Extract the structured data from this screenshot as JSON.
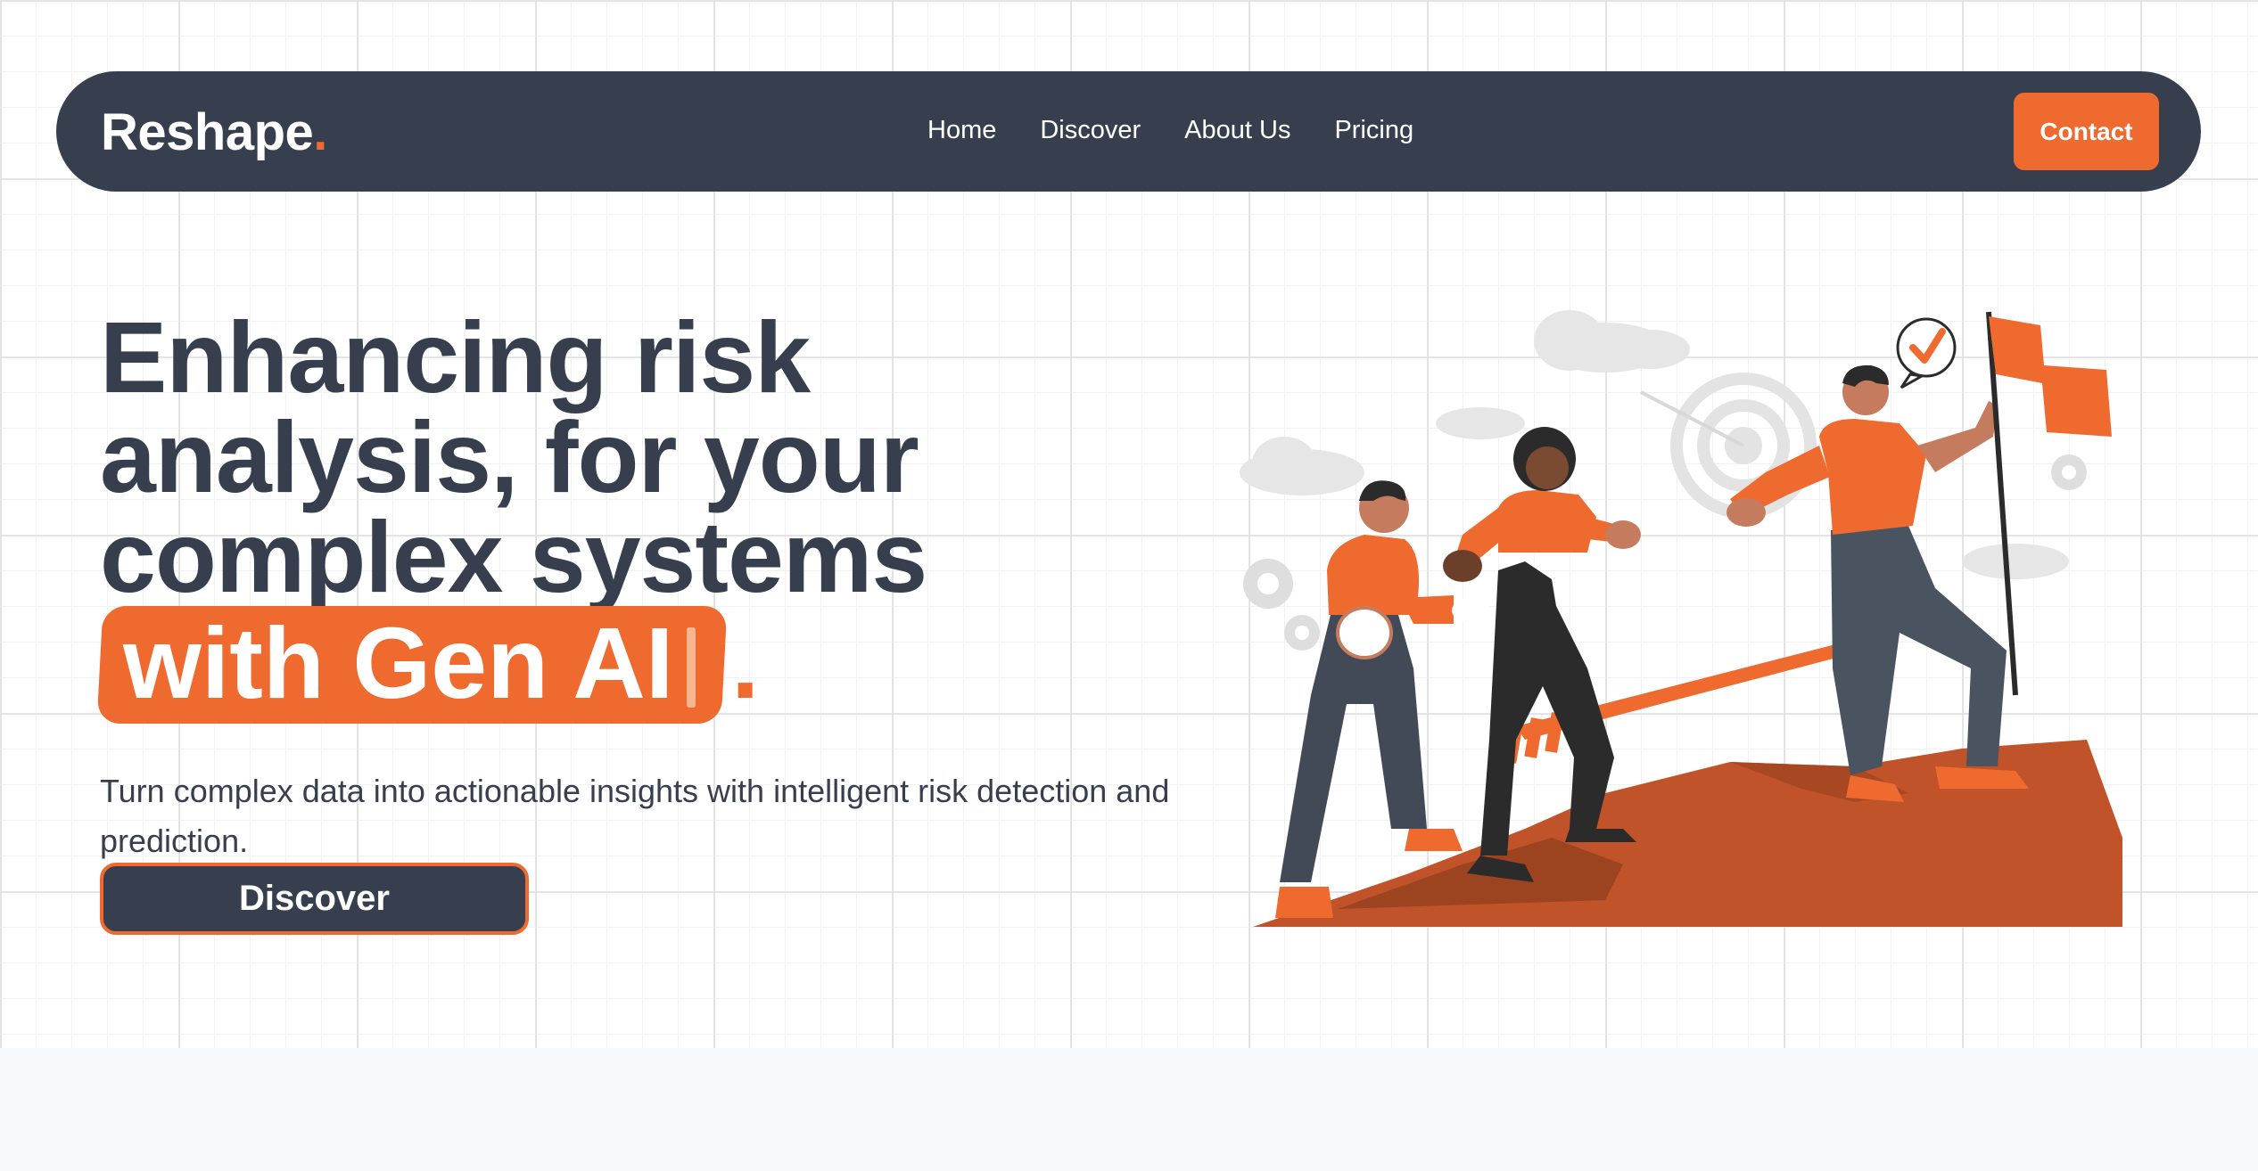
{
  "brand": {
    "name": "Reshape",
    "dot": ".",
    "accent": "#ef6a2f",
    "dark": "#373f4f"
  },
  "nav": {
    "links": [
      "Home",
      "Discover",
      "About Us",
      "Pricing"
    ],
    "contact_label": "Contact"
  },
  "hero": {
    "headline_lines": [
      "Enhancing risk",
      "analysis, for your",
      "complex systems"
    ],
    "highlight": "with Gen AI",
    "period": ".",
    "subtitle": "Turn complex data into actionable insights with intelligent risk detection and prediction.",
    "cta_label": "Discover"
  },
  "illustration": {
    "icons": [
      "checkmark-icon",
      "flag-icon",
      "target-icon",
      "gear-icon",
      "arrow-icon",
      "cloud-icon"
    ]
  }
}
